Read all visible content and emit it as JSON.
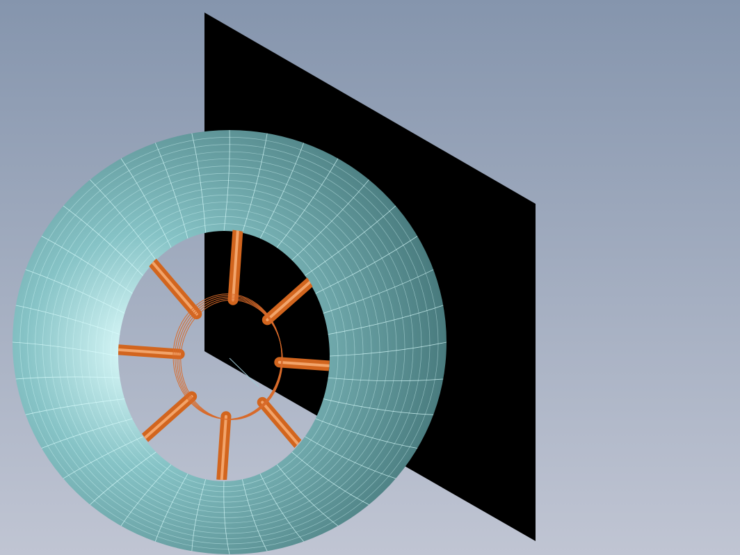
{
  "viewport": {
    "background_top": "#8595ad",
    "background_bottom": "#c0c5d3"
  },
  "scene": {
    "plane": {
      "color": "#000000"
    },
    "torus": {
      "base_color": "#86c3c6",
      "highlight_color": "#e4ffff",
      "shadow_color": "#3d6d70",
      "mesh_line_color": "#dcffff",
      "segments_around": 36,
      "segments_tube": 14
    },
    "spokes": {
      "color": "#d2651e",
      "count": 8
    },
    "hub_ring": {
      "color": "#d86a2a",
      "strands": 5
    }
  }
}
